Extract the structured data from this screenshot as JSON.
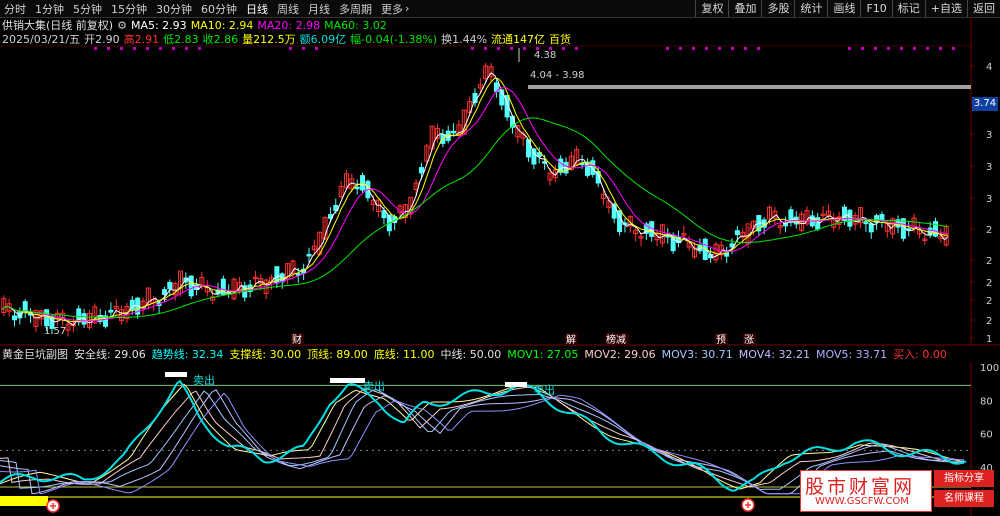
{
  "toolbar": {
    "periods": [
      "分时",
      "1分钟",
      "5分钟",
      "15分钟",
      "30分钟",
      "60分钟",
      "日线",
      "周线",
      "月线",
      "多周期",
      "更多"
    ],
    "active_period": "日线",
    "more_arrow": "›",
    "right_buttons": [
      "复权",
      "叠加",
      "多股",
      "统计",
      "画线",
      "F10",
      "标记",
      "+自选",
      "返回"
    ]
  },
  "info": {
    "stock_name": "供销大集(日线 前复权)",
    "ma5": "MA5: 2.93",
    "ma10": "MA10: 2.94",
    "ma20": "MA20: 2.98",
    "ma60": "MA60: 3.02",
    "date": "2025/03/21/五",
    "open": "开2.90",
    "high": "高2.91",
    "low": "低2.83",
    "close": "收2.86",
    "volume": "量212.5万",
    "amount": "额6.09亿",
    "change": "幅-0.04(-1.38%)",
    "turnover": "换1.44%",
    "float_value": "流通147亿",
    "sector": "百货"
  },
  "colors": {
    "bg": "#000000",
    "up": "#ff3232",
    "down": "#54ffff",
    "ma5": "#ffffff",
    "ma10": "#ffff00",
    "ma20": "#ff00ff",
    "ma60": "#00e600",
    "gray_bar": "#a0a0a0"
  },
  "price_axis": [
    "4",
    "3",
    "3",
    "3",
    "3",
    "2",
    "2",
    "2",
    "2",
    "2",
    "1"
  ],
  "current_price_tag": "3.74",
  "annotations": {
    "high_label": "4.38",
    "range_label": "4.04 - 3.98",
    "low_label": "1.57",
    "ticks_label": "1",
    "events": [
      "财",
      "解",
      "榜减",
      "预",
      "涨"
    ]
  },
  "sub": {
    "name": "黄金巨坑副图",
    "items": [
      {
        "text": "安全线: 29.06",
        "color": "#e0e0e0"
      },
      {
        "text": "趋势线: 32.34",
        "color": "#00ffff"
      },
      {
        "text": "支撑线: 30.00",
        "color": "#ffff00"
      },
      {
        "text": "顶线: 89.00",
        "color": "#ffff00"
      },
      {
        "text": "底线: 11.00",
        "color": "#ffff00"
      },
      {
        "text": "中线: 50.00",
        "color": "#e0e0e0"
      },
      {
        "text": "MOV1: 27.05",
        "color": "#00ff00"
      },
      {
        "text": "MOV2: 29.06",
        "color": "#ffcccc"
      },
      {
        "text": "MOV3: 30.71",
        "color": "#a0c8ff"
      },
      {
        "text": "MOV4: 32.21",
        "color": "#c0c0ff"
      },
      {
        "text": "MOV5: 33.71",
        "color": "#b0b0ff"
      },
      {
        "text": "买入: 0.00",
        "color": "#ff3232"
      }
    ],
    "axis": [
      "100",
      "80",
      "60",
      "40"
    ],
    "sell_label": "卖出"
  },
  "watermark": {
    "brand": "股市财富网",
    "url": "WWW.GSCFW.COM",
    "tag1": "指标分享",
    "tag2": "名师课程"
  }
}
